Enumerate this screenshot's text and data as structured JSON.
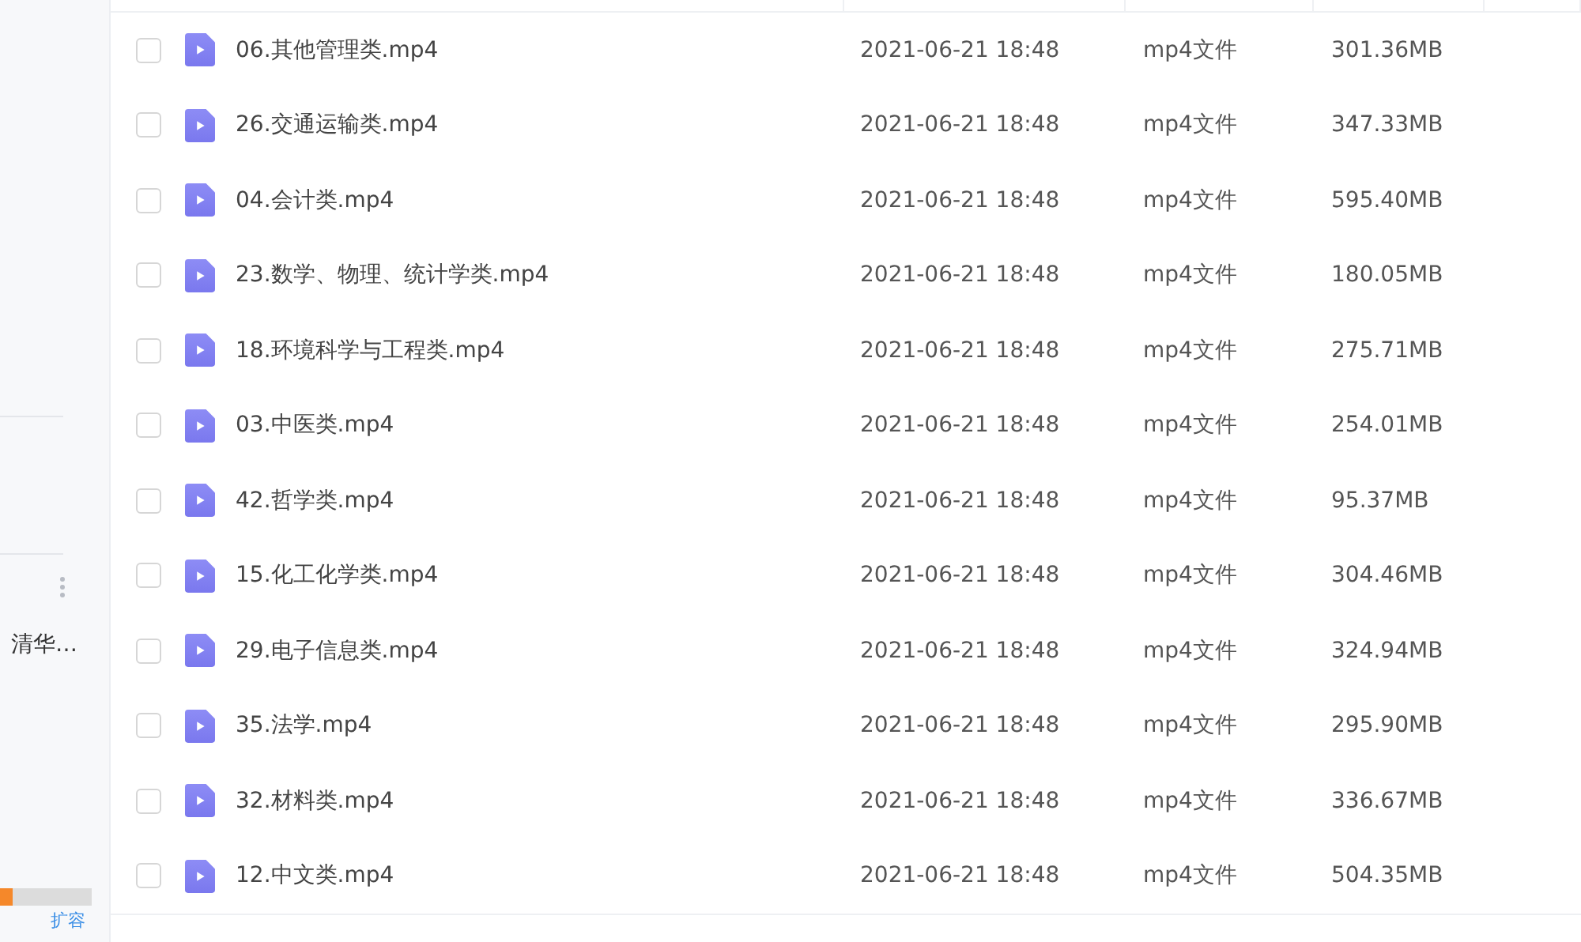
{
  "sidebar": {
    "folder_label": "清华…",
    "storage": {
      "level": 0.14
    },
    "expand_link": "扩容"
  },
  "files": [
    {
      "name": "06.其他管理类.mp4",
      "date": "2021-06-21 18:48",
      "type": "mp4文件",
      "size": "301.36MB",
      "checked": false
    },
    {
      "name": "26.交通运输类.mp4",
      "date": "2021-06-21 18:48",
      "type": "mp4文件",
      "size": "347.33MB",
      "checked": false
    },
    {
      "name": "04.会计类.mp4",
      "date": "2021-06-21 18:48",
      "type": "mp4文件",
      "size": "595.40MB",
      "checked": false
    },
    {
      "name": "23.数学、物理、统计学类.mp4",
      "date": "2021-06-21 18:48",
      "type": "mp4文件",
      "size": "180.05MB",
      "checked": false
    },
    {
      "name": "18.环境科学与工程类.mp4",
      "date": "2021-06-21 18:48",
      "type": "mp4文件",
      "size": "275.71MB",
      "checked": false
    },
    {
      "name": "03.中医类.mp4",
      "date": "2021-06-21 18:48",
      "type": "mp4文件",
      "size": "254.01MB",
      "checked": false
    },
    {
      "name": "42.哲学类.mp4",
      "date": "2021-06-21 18:48",
      "type": "mp4文件",
      "size": "95.37MB",
      "checked": false
    },
    {
      "name": "15.化工化学类.mp4",
      "date": "2021-06-21 18:48",
      "type": "mp4文件",
      "size": "304.46MB",
      "checked": false
    },
    {
      "name": "29.电子信息类.mp4",
      "date": "2021-06-21 18:48",
      "type": "mp4文件",
      "size": "324.94MB",
      "checked": false
    },
    {
      "name": "35.法学.mp4",
      "date": "2021-06-21 18:48",
      "type": "mp4文件",
      "size": "295.90MB",
      "checked": false
    },
    {
      "name": "32.材料类.mp4",
      "date": "2021-06-21 18:48",
      "type": "mp4文件",
      "size": "336.67MB",
      "checked": false
    },
    {
      "name": "12.中文类.mp4",
      "date": "2021-06-21 18:48",
      "type": "mp4文件",
      "size": "504.35MB",
      "checked": false
    }
  ]
}
